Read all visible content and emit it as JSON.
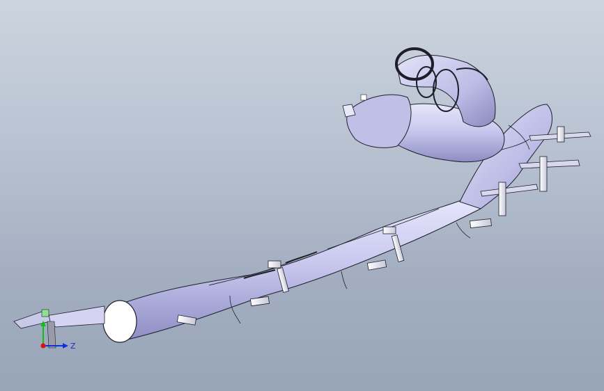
{
  "viewport": {
    "background_top": "#cdd4df",
    "background_bottom": "#98a5b8"
  },
  "model": {
    "tube_color": "#c9c9ef",
    "tube_shadow": "#8d8dc4",
    "edge_color": "#1e1e2a",
    "bolt_color": "#f4f4fb"
  },
  "triad": {
    "z_label": "Z",
    "x_axis_color": "#e01010",
    "y_axis_color": "#10c010",
    "z_axis_color": "#1030e0"
  }
}
